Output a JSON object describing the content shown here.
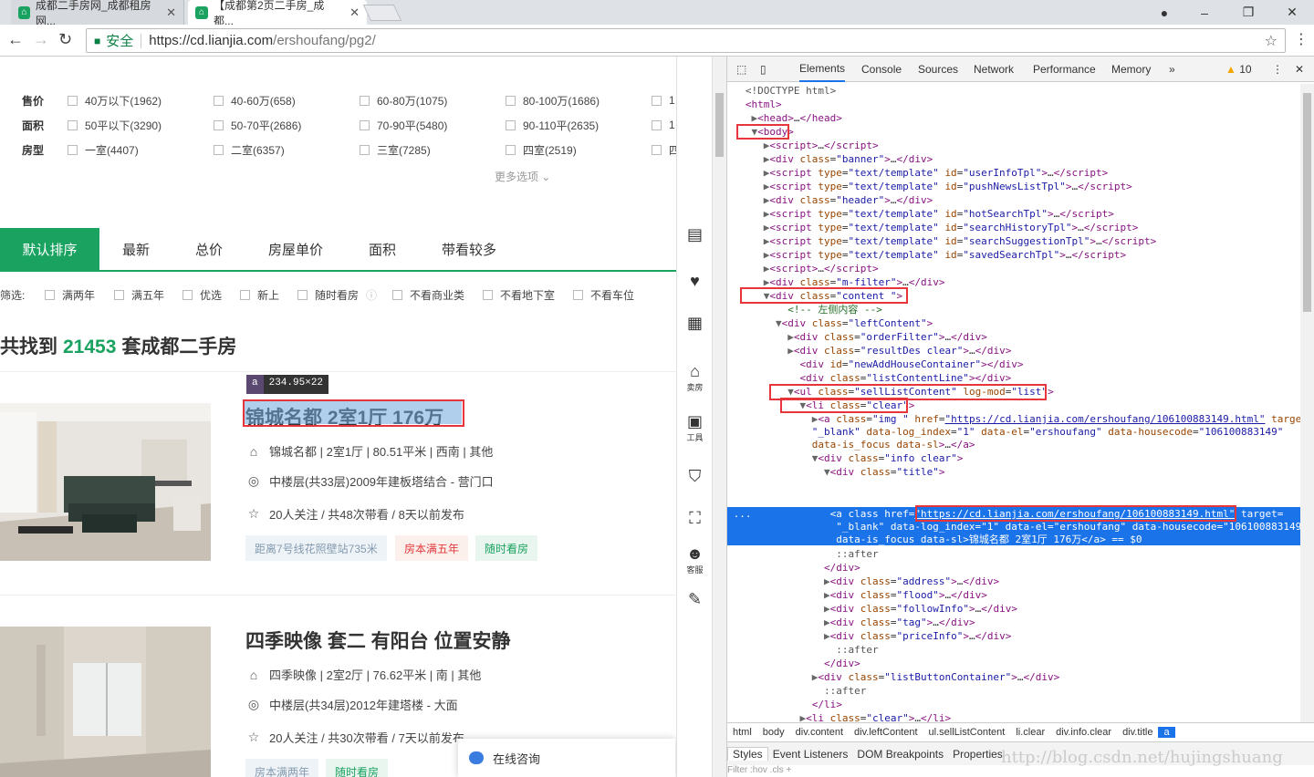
{
  "browser": {
    "tabs": [
      {
        "title": "成都二手房网_成都租房网..."
      },
      {
        "title": "【成都第2页二手房_成都..."
      }
    ],
    "secure_label": "安全",
    "url_host": "https://cd.lianjia.com",
    "url_path": "/ershoufang/pg2/"
  },
  "filters": {
    "rows": [
      {
        "label": "售价",
        "options": [
          "40万以下(1962)",
          "40-60万(658)",
          "60-80万(1075)",
          "80-100万(1686)",
          "1"
        ]
      },
      {
        "label": "面积",
        "options": [
          "50平以下(3290)",
          "50-70平(2686)",
          "70-90平(5480)",
          "90-110平(2635)",
          "1"
        ]
      },
      {
        "label": "房型",
        "options": [
          "一室(4407)",
          "二室(6357)",
          "三室(7285)",
          "四室(2519)",
          "四"
        ]
      }
    ],
    "more": "更多选项 ⌄"
  },
  "sort": {
    "tabs": [
      "默认排序",
      "最新",
      "总价",
      "房屋单价",
      "面积",
      "带看较多"
    ]
  },
  "screen": {
    "label": "筛选:",
    "options": [
      "满两年",
      "满五年",
      "优选",
      "新上",
      "随时看房",
      "不看商业类",
      "不看地下室",
      "不看车位"
    ]
  },
  "result": {
    "prefix": "共找到",
    "count": "21453",
    "suffix": "套成都二手房"
  },
  "tooltip": {
    "tag": "a",
    "size": "234.95×22"
  },
  "houses": [
    {
      "title": "锦城名都 2室1厅 176万",
      "address": "锦城名都 | 2室1厅 | 80.51平米 | 西南 | 其他",
      "flood": "中楼层(共33层)2009年建板塔结合 - 营门口",
      "follow": "20人关注 / 共48次带看 / 8天以前发布",
      "tags": [
        "距离7号线花照壁站735米",
        "房本满五年",
        "随时看房"
      ]
    },
    {
      "title": "四季映像 套二 有阳台 位置安静",
      "address": "四季映像 | 2室2厅 | 76.62平米 | 南 | 其他",
      "flood": "中楼层(共34层)2012年建塔楼 - 大面",
      "follow": "20人关注 / 共30次带看 / 7天以前发布",
      "tags": [
        "房本满两年",
        "随时看房"
      ]
    }
  ],
  "sidebar": {
    "items": [
      "",
      "",
      "",
      "卖房",
      "工具",
      "",
      "",
      "客服",
      ""
    ]
  },
  "consult": {
    "label": "在线咨询"
  },
  "devtools": {
    "tabs": [
      "Elements",
      "Console",
      "Sources",
      "Network",
      "Performance",
      "Memory"
    ],
    "warnings": "10",
    "crumbs": [
      "html",
      "body",
      "div.content",
      "div.leftContent",
      "ul.sellListContent",
      "li.clear",
      "div.info.clear",
      "div.title",
      "a"
    ],
    "subtabs": [
      "Styles",
      "Event Listeners",
      "DOM Breakpoints",
      "Properties"
    ],
    "filter_text": "Filter          :hov   .cls   +"
  },
  "watermark": "http://blog.csdn.net/hujingshuang"
}
